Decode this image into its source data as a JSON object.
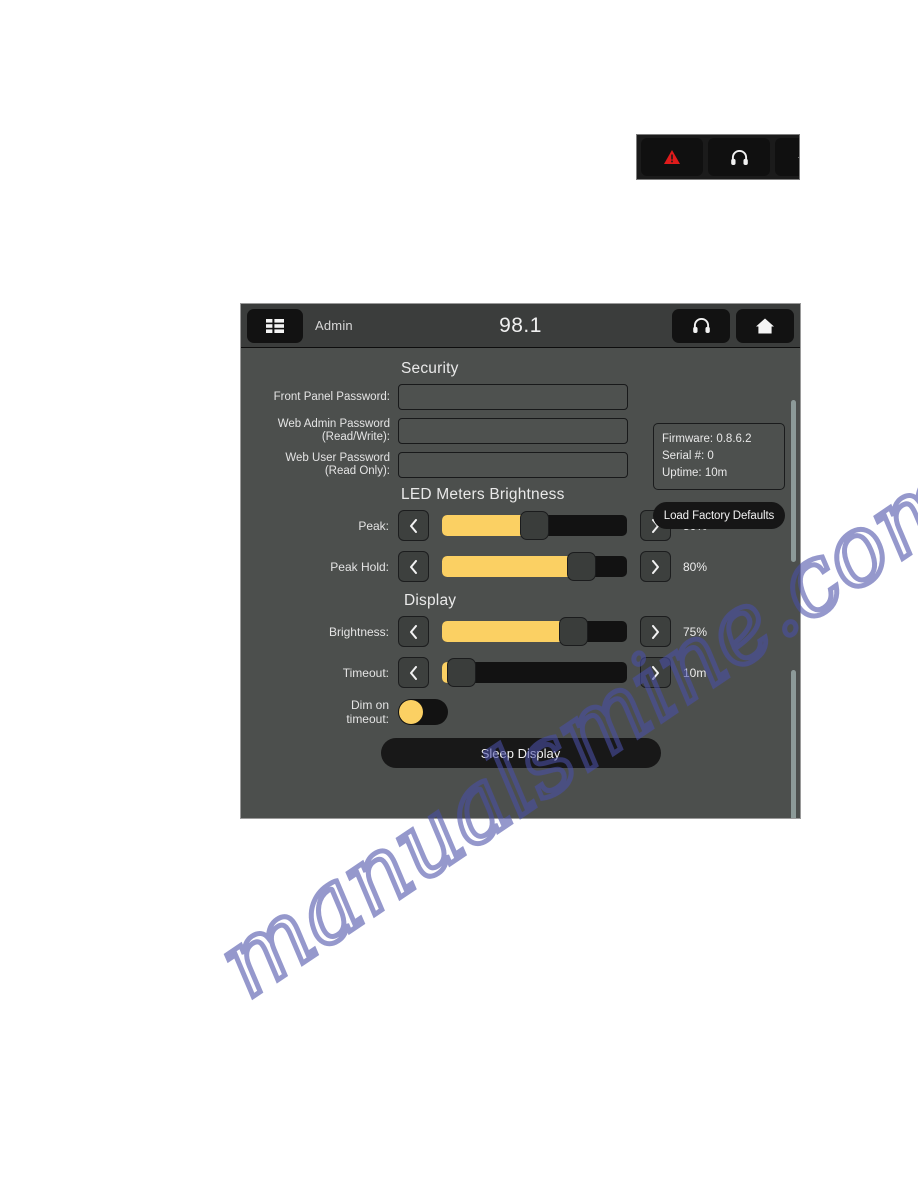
{
  "fragment_toolbar": {
    "buttons": [
      {
        "name": "alarm-warning",
        "icon": "warning-triangle-icon",
        "color": "#e01b1b"
      },
      {
        "name": "headphones",
        "icon": "headphones-icon"
      },
      {
        "name": "home",
        "icon": "home-icon"
      }
    ]
  },
  "titlebar": {
    "menu_icon": "grid-menu-icon",
    "user_label": "Admin",
    "frequency": "98.1",
    "headphones_icon": "headphones-icon",
    "home_icon": "home-icon"
  },
  "security": {
    "heading": "Security",
    "fields": [
      {
        "label": "Front Panel Password:",
        "value": "",
        "placeholder": ""
      },
      {
        "label": "Web Admin Password\n(Read/Write):",
        "label_line1": "Web Admin Password",
        "label_line2": "(Read/Write):",
        "value": "",
        "placeholder": ""
      },
      {
        "label": "Web User Password\n(Read Only):",
        "label_line1": "Web User Password",
        "label_line2": "(Read Only):",
        "value": "",
        "placeholder": ""
      }
    ],
    "info": {
      "firmware_label": "Firmware:",
      "firmware_value": "0.8.6.2",
      "serial_label": "Serial #:",
      "serial_value": "0",
      "uptime_label": "Uptime:",
      "uptime_value": "10m"
    },
    "factory_button": "Load Factory Defaults"
  },
  "led_meters": {
    "heading": "LED Meters Brightness",
    "rows": [
      {
        "label": "Peak:",
        "value_text": "50%",
        "percent": 50,
        "dec_icon": "chevron-left-icon",
        "inc_icon": "chevron-right-icon"
      },
      {
        "label": "Peak Hold:",
        "value_text": "80%",
        "percent": 80,
        "dec_icon": "chevron-left-icon",
        "inc_icon": "chevron-right-icon"
      }
    ]
  },
  "display": {
    "heading": "Display",
    "rows": [
      {
        "label": "Brightness:",
        "value_text": "75%",
        "percent": 75,
        "dec_icon": "chevron-left-icon",
        "inc_icon": "chevron-right-icon"
      },
      {
        "label": "Timeout:",
        "value_text": "10m",
        "percent": 3,
        "dec_icon": "chevron-left-icon",
        "inc_icon": "chevron-right-icon"
      }
    ],
    "dim_on_timeout": {
      "label_line1": "Dim on",
      "label_line2": "timeout:",
      "state": "off"
    },
    "sleep_button": "Sleep Display"
  },
  "watermark": {
    "text": "manualsmine.com",
    "color": "#4a4fa8"
  },
  "colors": {
    "accent_yellow": "#fbd063",
    "panel_bg": "#4c4f4d",
    "titlebar_bg": "#3b3d3c",
    "track_dark": "#121212",
    "warning_red": "#e01b1b"
  }
}
